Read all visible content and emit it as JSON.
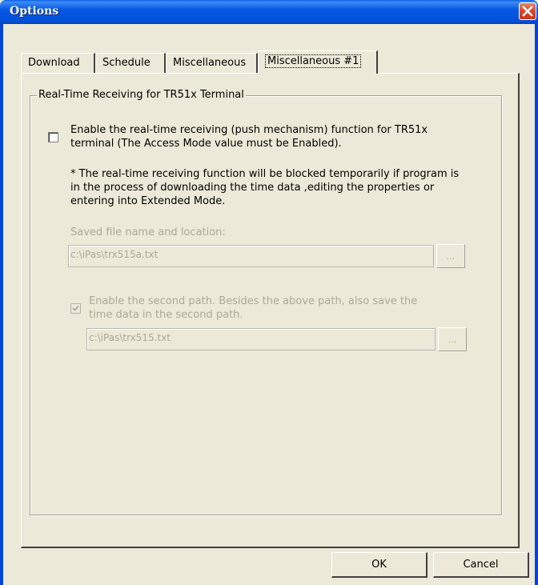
{
  "window": {
    "title": "Options"
  },
  "tabs": [
    {
      "label": "Download",
      "active": false
    },
    {
      "label": "Schedule",
      "active": false
    },
    {
      "label": "Miscellaneous",
      "active": false
    },
    {
      "label": "Miscellaneous #1",
      "active": true
    }
  ],
  "group": {
    "legend": "Real-Time Receiving for TR51x Terminal",
    "enable_realtime": {
      "checked": false,
      "line1": "Enable the real-time receiving (push mechanism) function for TR51x",
      "line2": "terminal (The Access Mode value must be Enabled)."
    },
    "note": {
      "line1": "* The real-time receiving function will be blocked temporarily if program is",
      "line2": "in the process of downloading the time data ,editing the properties or",
      "line3": "entering into Extended Mode."
    },
    "saved_file": {
      "label": "Saved file name and location:",
      "value": "c:\\iPas\\trx515a.txt",
      "browse_label": "..."
    },
    "second_path": {
      "checked": true,
      "line1": "Enable the second path. Besides the above path, also save the",
      "line2": "time data in the second path.",
      "value": "c:\\iPas\\trx515.txt",
      "browse_label": "..."
    }
  },
  "buttons": {
    "ok": "OK",
    "cancel": "Cancel"
  },
  "colors": {
    "titlebar": "#0858e3",
    "dialog_bg": "#ece9d8",
    "disabled_text": "#aca899",
    "close_button": "#d9452a"
  }
}
